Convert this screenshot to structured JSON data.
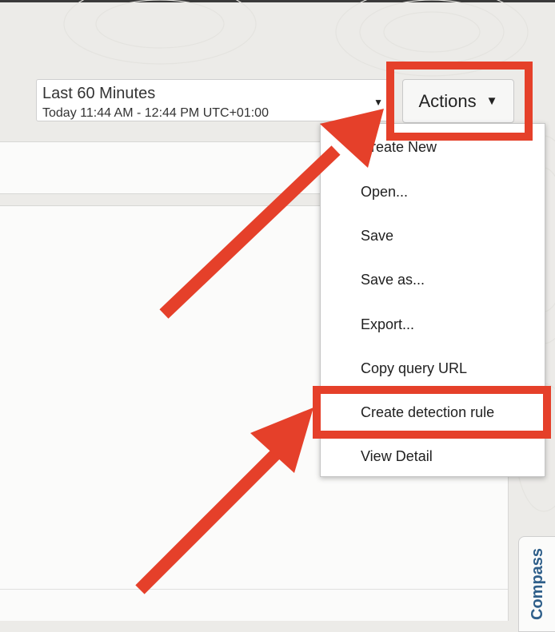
{
  "time_range": {
    "label": "Last 60 Minutes",
    "detail": "Today 11:44 AM - 12:44 PM UTC+01:00"
  },
  "actions": {
    "label": "Actions"
  },
  "menu": {
    "items": [
      "Create New",
      "Open...",
      "Save",
      "Save as...",
      "Export...",
      "Copy query URL",
      "Create detection rule",
      "View Detail"
    ]
  },
  "compass_tab": {
    "label": "Compass"
  },
  "colors": {
    "highlight": "#e5402a",
    "compass_text": "#2f5f8a"
  }
}
